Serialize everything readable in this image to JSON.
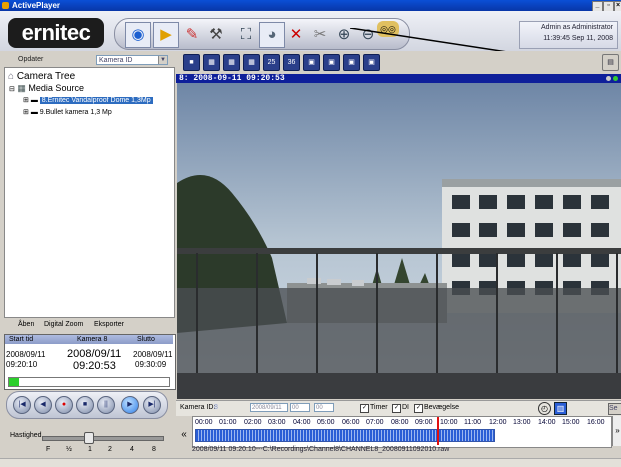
{
  "window": {
    "title": "ActivePlayer",
    "controls": [
      "_",
      "̲F",
      "x"
    ]
  },
  "brand": {
    "logo_text": "ernitec"
  },
  "toolbar": {
    "buttons": [
      {
        "name": "eye-icon",
        "glyph": "👁"
      },
      {
        "name": "export-folder-icon",
        "glyph": "📁"
      },
      {
        "name": "paint-icon",
        "glyph": "🎨"
      },
      {
        "name": "tools-icon",
        "glyph": "🔧"
      },
      {
        "name": "fullscreen-icon",
        "glyph": "⛶"
      },
      {
        "name": "capture-icon",
        "glyph": "📷"
      },
      {
        "name": "remove-icon",
        "glyph": "✖"
      },
      {
        "name": "disconnect-icon",
        "glyph": "✂"
      },
      {
        "name": "zoom-in-icon",
        "glyph": "🔍"
      },
      {
        "name": "zoom-out-icon",
        "glyph": "🔎"
      },
      {
        "name": "binoculars-icon",
        "glyph": "◎"
      }
    ]
  },
  "admin": {
    "line1": "Admin as Administrator",
    "line2": "11:39:45 Sep 11, 2008"
  },
  "sidebar": {
    "update_label": "Opdater",
    "camera_select": {
      "value": "Kamera ID",
      "placeholder": "Kamera ID"
    },
    "tree": {
      "root": "Camera Tree",
      "media": "Media Source",
      "items": [
        {
          "label": "8.Ernitec Vandalproof Dome 1,3Mp",
          "selected": true
        },
        {
          "label": "9.Bullet kamera 1,3 Mp",
          "selected": false
        }
      ]
    },
    "tabs": [
      "Åben",
      "Digital Zoom",
      "Eksporter"
    ]
  },
  "playback": {
    "headers": [
      "Start tid",
      "Kamera 8",
      "Slutto"
    ],
    "start": {
      "date": "2008/09/11",
      "time": "09:20:10"
    },
    "current": {
      "date": "2008/09/11",
      "time": "09:20:53"
    },
    "end": {
      "date": "2008/09/11",
      "time": "09:30:09"
    },
    "progress": 0.06,
    "speed_label": "Hastighed",
    "speed_ticks": [
      "F",
      "½",
      "1",
      "2",
      "4",
      "8"
    ]
  },
  "viewer": {
    "layout_buttons": [
      "1",
      "4",
      "6",
      "9",
      "25",
      "36",
      "",
      "",
      "",
      ""
    ],
    "channel_header": "8:  2008-09-11 09:20:53"
  },
  "controls": {
    "camera_id_label": "Kamera ID:",
    "camera_id_value": "8",
    "date_value": "2008/09/11",
    "hour_value": "00",
    "min_value": "00",
    "timer_label": "Timer",
    "di_label": "DI",
    "motion_label": "Bevægelse",
    "search_label": "Se"
  },
  "timeline": {
    "hours": [
      "00:00",
      "01:00",
      "02:00",
      "03:00",
      "04:00",
      "05:00",
      "06:00",
      "07:00",
      "08:00",
      "09:00",
      "10:00",
      "11:00",
      "12:00",
      "13:00",
      "14:00",
      "15:00",
      "16:00"
    ],
    "status": "2008/09/11 09:20:10---C:\\Recordings\\Channel8\\CHANNEL8_20080911092010.raw"
  }
}
